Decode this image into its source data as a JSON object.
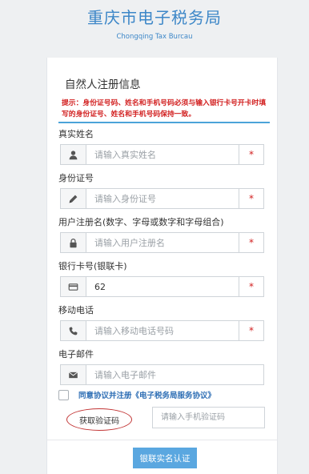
{
  "header": {
    "title": "重庆市电子税务局",
    "subtitle": "Chongqing Tax Burcau"
  },
  "form": {
    "title": "自然人注册信息",
    "notice": "提示：身份证号码、姓名和手机号码必须与输入银行卡号开卡时填写的身份证号、姓名和手机号码保持一致。",
    "required_mark": "*",
    "fields": [
      {
        "label": "真实姓名",
        "placeholder": "请输入真实姓名",
        "value": "",
        "icon": "user-icon"
      },
      {
        "label": "身份证号",
        "placeholder": "请输入身份证号",
        "value": "",
        "icon": "pencil-icon"
      },
      {
        "label": "用户注册名(数字、字母或数字和字母组合)",
        "placeholder": "请输入用户注册名",
        "value": "",
        "icon": "lock-icon"
      },
      {
        "label": "银行卡号(银联卡)",
        "placeholder": "",
        "value": "62",
        "icon": "credit-card-icon"
      },
      {
        "label": "移动电话",
        "placeholder": "请输入移动电话号码",
        "value": "",
        "icon": "phone-icon"
      },
      {
        "label": "电子邮件",
        "placeholder": "请输入电子邮件",
        "value": "",
        "icon": "envelope-icon"
      }
    ],
    "agreement_label": "同意协议并注册《电子税务局服务协议》",
    "get_code_label": "获取验证码",
    "sms_placeholder": "请输入手机验证码",
    "submit_label": "银联实名认证"
  }
}
